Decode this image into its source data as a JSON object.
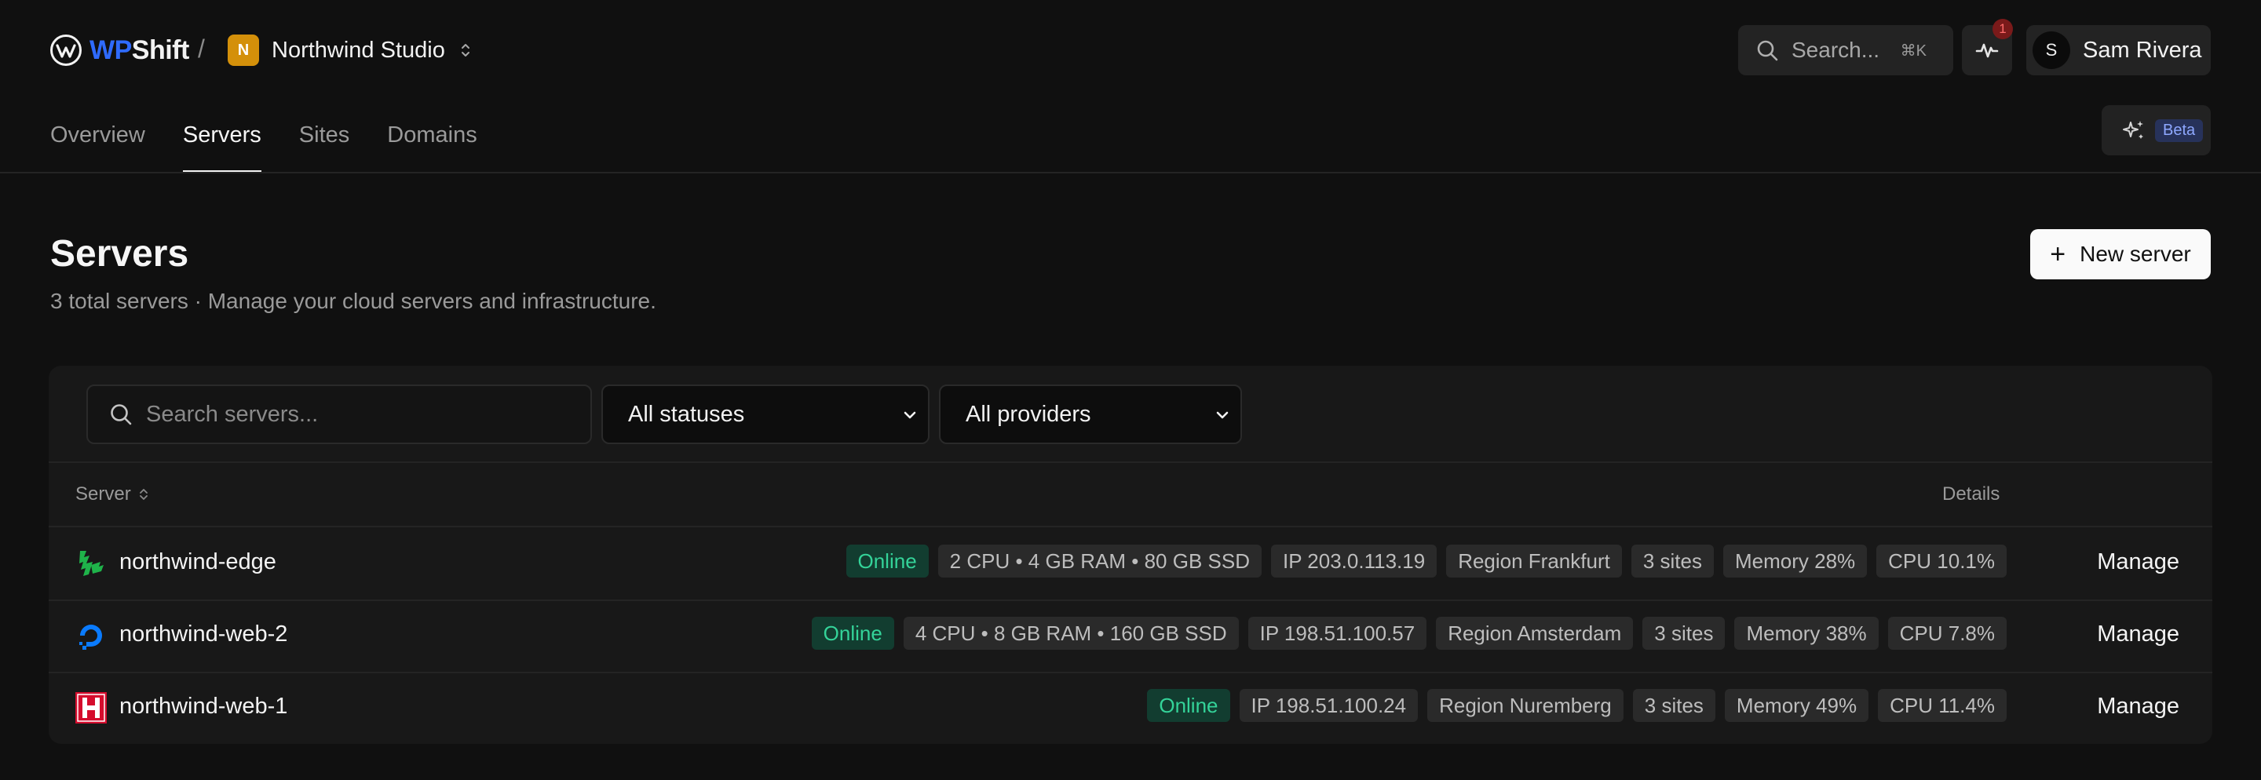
{
  "brand": {
    "name_part1": "WP",
    "name_part2": "Shift",
    "separator": "/"
  },
  "team": {
    "initial": "N",
    "name": "Northwind Studio"
  },
  "header": {
    "search_label": "Search...",
    "search_shortcut": "⌘K",
    "notification_count": "1",
    "user_initial": "S",
    "user_name": "Sam Rivera",
    "beta_label": "Beta"
  },
  "tabs": [
    {
      "label": "Overview",
      "active": false
    },
    {
      "label": "Servers",
      "active": true
    },
    {
      "label": "Sites",
      "active": false
    },
    {
      "label": "Domains",
      "active": false
    }
  ],
  "page": {
    "title": "Servers",
    "subtitle": "3 total servers · Manage your cloud servers and infrastructure.",
    "new_button_label": "New server"
  },
  "filters": {
    "search_placeholder": "Search servers...",
    "status_selected": "All statuses",
    "provider_selected": "All providers"
  },
  "table": {
    "col_server": "Server",
    "col_details": "Details",
    "action_label": "Manage",
    "rows": [
      {
        "name": "northwind-edge",
        "provider_icon": "linode-icon",
        "chips": [
          "Online",
          "2 CPU • 4 GB RAM • 80 GB SSD",
          "IP 203.0.113.19",
          "Region Frankfurt",
          "3 sites",
          "Memory 28%",
          "CPU 10.1%"
        ]
      },
      {
        "name": "northwind-web-2",
        "provider_icon": "digitalocean-icon",
        "chips": [
          "Online",
          "4 CPU • 8 GB RAM • 160 GB SSD",
          "IP 198.51.100.57",
          "Region Amsterdam",
          "3 sites",
          "Memory 38%",
          "CPU 7.8%"
        ]
      },
      {
        "name": "northwind-web-1",
        "provider_icon": "hetzner-icon",
        "chips": [
          "Online",
          "IP 198.51.100.24",
          "Region Nuremberg",
          "3 sites",
          "Memory 49%",
          "CPU 11.4%"
        ]
      }
    ]
  },
  "colors": {
    "background": "#101010",
    "card": "#181818",
    "brand_blue": "#2f6bff",
    "online_bg": "#123d30",
    "online_text": "#34d399",
    "team_avatar": "#d4900a",
    "linode_green": "#1fb34a",
    "digitalocean_blue": "#0a7bff",
    "hetzner_red": "#d50c2d"
  }
}
